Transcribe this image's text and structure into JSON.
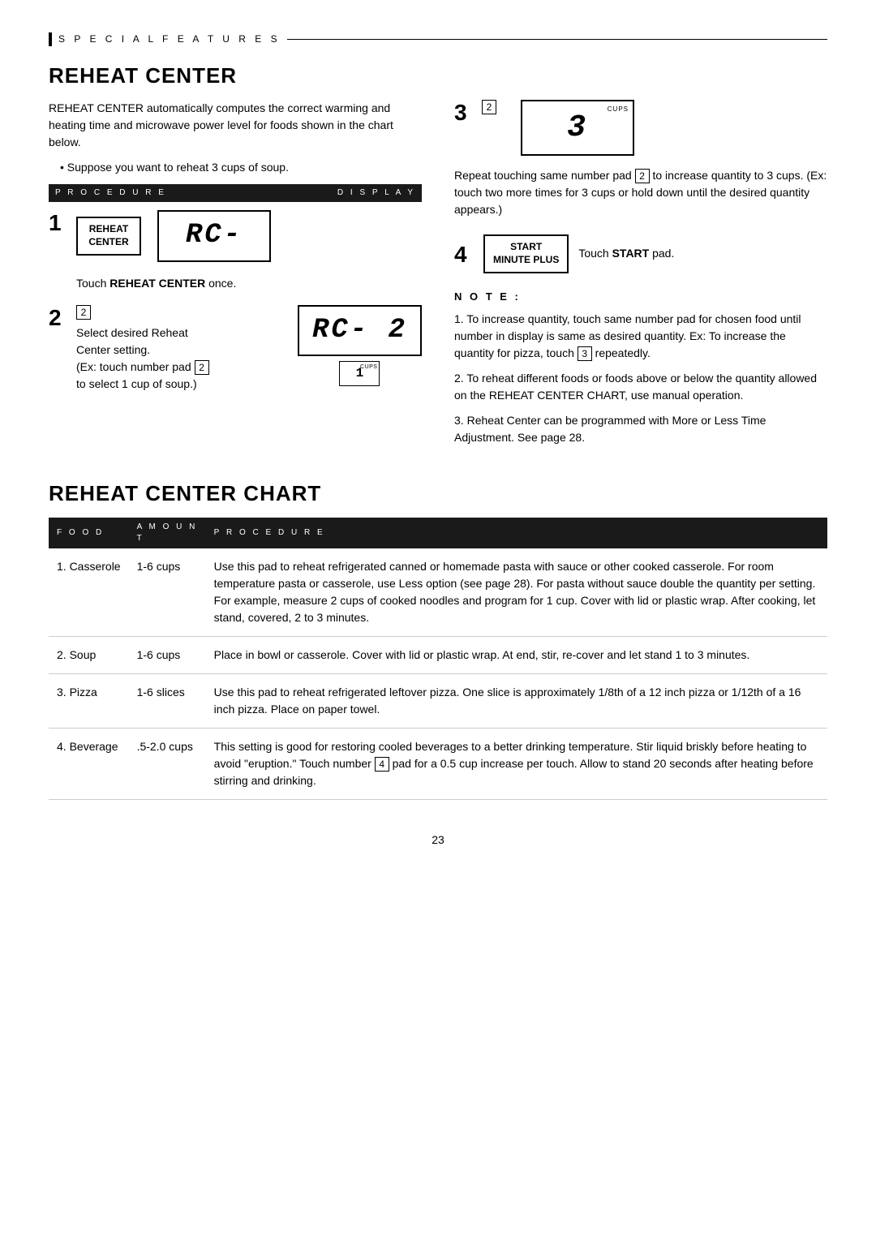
{
  "page": {
    "section_label": "S P E C I A L   F E A T U R E S",
    "page_number": "23"
  },
  "reheat_center": {
    "heading": "Reheat Center",
    "intro": "REHEAT CENTER automatically computes the correct warming and heating time and microwave power level for foods shown in the chart below.",
    "bullet": "Suppose you want to reheat 3 cups of soup.",
    "proc_label": "P R O C E D U R E",
    "disp_label": "D I S P L A Y",
    "step1": {
      "number": "1",
      "button_line1": "Reheat",
      "button_line2": "Center",
      "display_text": "RC-",
      "instruction": "Touch REHEAT CENTER once.",
      "instruction_bold": "REHEAT CENTER"
    },
    "step2": {
      "number": "2",
      "boxed_num": "2",
      "display_main": "RC- 2",
      "display_sub": "1",
      "cups_label": "CUPS",
      "desc_line1": "Select desired Reheat",
      "desc_line2": "Center setting.",
      "desc_line3": "(Ex: touch number pad",
      "desc_boxed": "2",
      "desc_line4": "to select 1 cup of soup.)"
    },
    "step3": {
      "number": "3",
      "boxed_num": "2",
      "display_main": "3",
      "cups_label": "CUPS",
      "instruction": "Repeat touching same number pad",
      "instruction_boxed": "2",
      "instruction2": "to increase quantity to 3 cups. (Ex: touch two more times for 3 cups or hold down until the desired quantity appears.)"
    },
    "step4": {
      "number": "4",
      "button_line1": "Start",
      "button_line2": "Minute Plus",
      "instruction_pre": "Touch ",
      "instruction_bold": "START",
      "instruction_post": " pad."
    },
    "note": {
      "heading": "N O T E :",
      "items": [
        "To increase quantity, touch same number pad for chosen food until number in display is same as desired quantity. Ex: To increase the quantity for pizza, touch 3 repeatedly.",
        "To reheat different foods or foods above or below the quantity allowed on the REHEAT CENTER CHART, use manual operation.",
        "Reheat Center can be programmed with More or Less Time Adjustment. See page 28."
      ],
      "item1_box": "3"
    }
  },
  "chart": {
    "heading": "Reheat Center Chart",
    "col_food": "F O O D",
    "col_amount": "A M O U N T",
    "col_procedure": "P R O C E D U R E",
    "rows": [
      {
        "food": "1. Casserole",
        "amount": "1-6 cups",
        "procedure": "Use this pad to reheat refrigerated canned or homemade pasta with sauce or other cooked casserole. For room temperature pasta or casserole, use Less option (see page 28). For pasta without sauce double the quantity per setting. For example, measure 2 cups of cooked noodles and program for 1 cup. Cover with lid or plastic wrap. After cooking, let stand, covered, 2 to 3 minutes."
      },
      {
        "food": "2. Soup",
        "amount": "1-6 cups",
        "procedure": "Place in bowl or casserole. Cover with lid or plastic wrap. At end, stir, re-cover and let stand 1 to 3 minutes."
      },
      {
        "food": "3. Pizza",
        "amount": "1-6 slices",
        "procedure": "Use this pad to reheat refrigerated leftover pizza. One slice is approximately 1/8th of a 12 inch pizza or 1/12th of a 16 inch pizza. Place on paper towel."
      },
      {
        "food": "4. Beverage",
        "amount": ".5-2.0 cups",
        "procedure": "This setting is good for restoring cooled beverages to a better drinking temperature. Stir liquid briskly before heating to avoid \"eruption.\" Touch number 4 pad for a 0.5 cup increase per touch. Allow to stand 20 seconds after heating before stirring and drinking."
      }
    ]
  }
}
